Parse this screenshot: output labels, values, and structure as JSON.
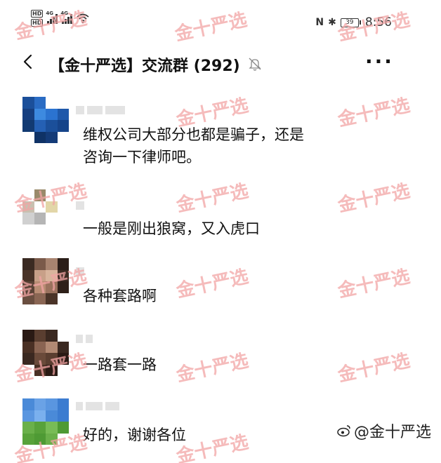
{
  "status_bar": {
    "hd1": "HD",
    "hd2": "HD",
    "net1": "4G",
    "net2": "4G",
    "nfc": "N",
    "bt": "✱",
    "battery": "39",
    "time": "8:56"
  },
  "header": {
    "title": "【金十严选】交流群 (292)",
    "more": "···"
  },
  "messages": [
    {
      "text_lines": [
        "维权公司大部分也都是骗子，还是",
        "咨询一下律师吧。"
      ]
    },
    {
      "text_lines": [
        "一般是刚出狼窝，又入虎口"
      ]
    },
    {
      "text_lines": [
        "各种套路啊"
      ]
    },
    {
      "text_lines": [
        "一路套一路"
      ]
    },
    {
      "text_lines": [
        "好的，谢谢各位"
      ]
    }
  ],
  "watermark": {
    "text": "金十严选"
  },
  "brand": {
    "icon": "weibo-icon",
    "text": "@金十严选"
  },
  "colors": {
    "watermark": "#f2a5a5",
    "text": "#111111"
  }
}
